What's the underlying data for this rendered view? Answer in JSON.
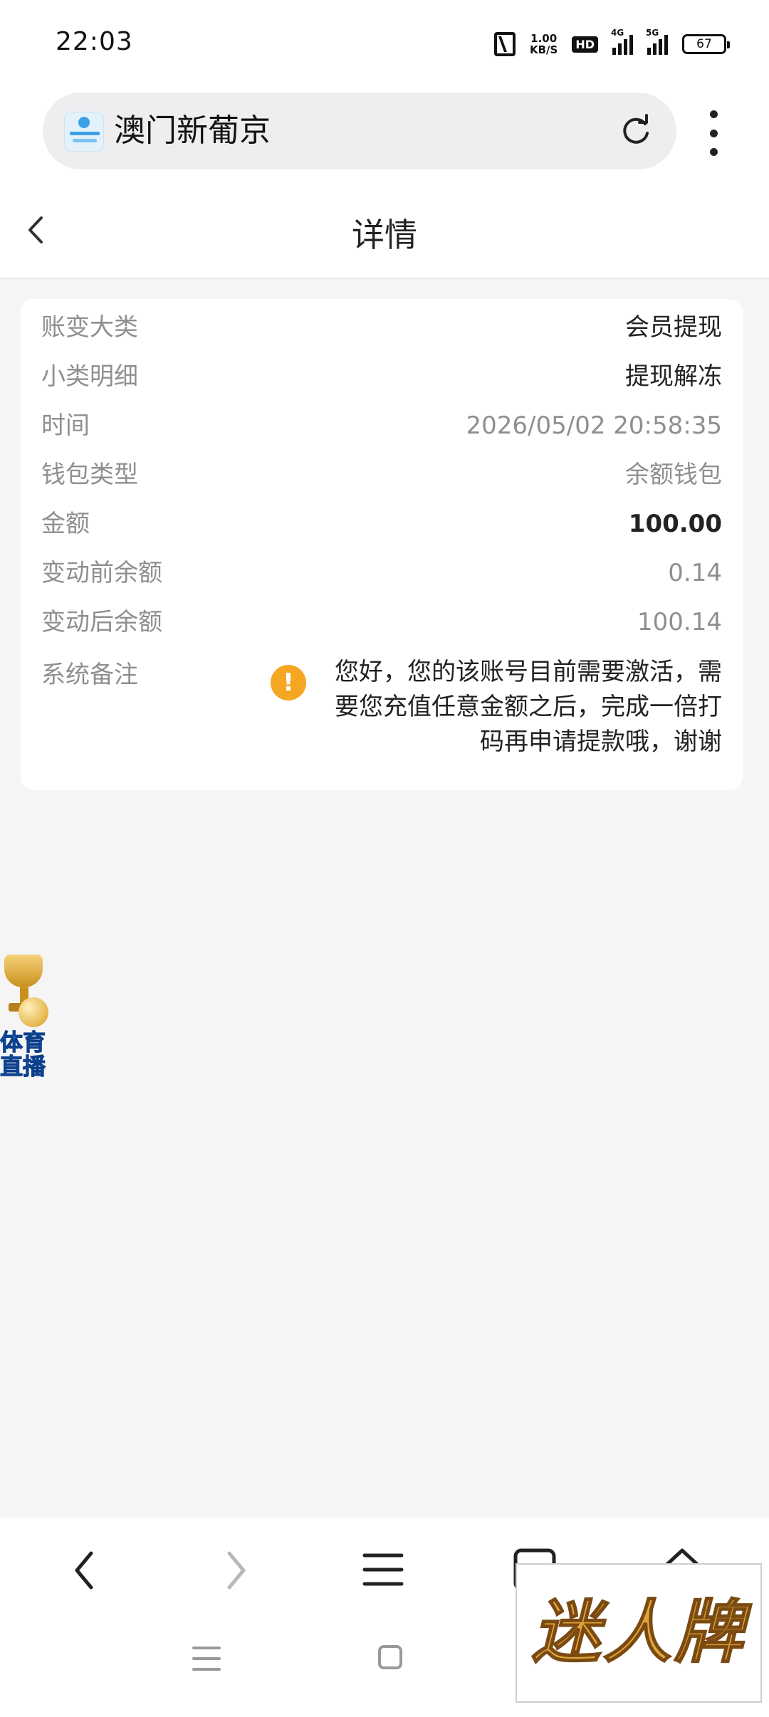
{
  "status_bar": {
    "time": "22:03",
    "net_speed_value": "1.00",
    "net_speed_unit": "KB/S",
    "hd_label": "HD",
    "signal1_tag": "4G",
    "signal2_tag": "5G",
    "battery": "67"
  },
  "browser": {
    "site_title": "澳门新葡京",
    "icons": {
      "favicon": "site-favicon",
      "reload": "reload-icon",
      "more": "more-vertical-icon"
    }
  },
  "header": {
    "title": "详情",
    "back_icon": "chevron-left-icon"
  },
  "detail": {
    "rows": [
      {
        "label": "账变大类",
        "value": "会员提现"
      },
      {
        "label": "小类明细",
        "value": "提现解冻"
      },
      {
        "label": "时间",
        "value": "2026/05/02 20:58:35"
      },
      {
        "label": "钱包类型",
        "value": "余额钱包"
      },
      {
        "label": "金额",
        "value": "100.00"
      },
      {
        "label": "变动前余额",
        "value": "0.14"
      },
      {
        "label": "变动后余额",
        "value": "100.14"
      }
    ],
    "note": {
      "label": "系统备注",
      "icon": "!",
      "text": "您好，您的该账号目前需要激活，需要您充值任意金额之后，完成一倍打码再申请提款哦，谢谢"
    }
  },
  "promo_float": {
    "label_line1": "体育",
    "label_line2": "直播"
  },
  "watermark": {
    "text": "迷人牌"
  },
  "colors": {
    "page_bg": "#f5f5f6",
    "card_bg": "#ffffff",
    "label_gray": "#8f8f93",
    "text_dark": "#222222",
    "warning": "#f5a623"
  }
}
